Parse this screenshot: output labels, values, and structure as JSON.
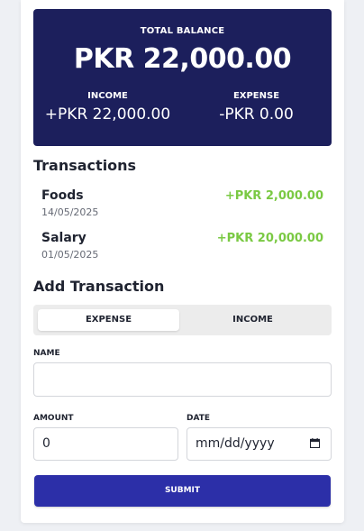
{
  "summary": {
    "total_label": "TOTAL BALANCE",
    "total_value": "PKR 22,000.00",
    "income_label": "INCOME",
    "income_value": "+PKR 22,000.00",
    "expense_label": "EXPENSE",
    "expense_value": "-PKR 0.00"
  },
  "transactions": {
    "title": "Transactions",
    "items": [
      {
        "name": "Foods",
        "date": "14/05/2025",
        "amount": "+PKR 2,000.00"
      },
      {
        "name": "Salary",
        "date": "01/05/2025",
        "amount": "+PKR 20,000.00"
      }
    ]
  },
  "form": {
    "title": "Add Transaction",
    "toggle": {
      "expense": "EXPENSE",
      "income": "INCOME",
      "selected": "EXPENSE"
    },
    "name_label": "NAME",
    "name_value": "",
    "amount_label": "AMOUNT",
    "amount_value": "0",
    "date_label": "DATE",
    "date_placeholder": "mm/dd/yyyy",
    "submit_label": "SUBMIT"
  },
  "colors": {
    "summary_bg": "#1c1f5c",
    "income_green": "#7ac943",
    "submit_bg": "#2c2fa8"
  }
}
